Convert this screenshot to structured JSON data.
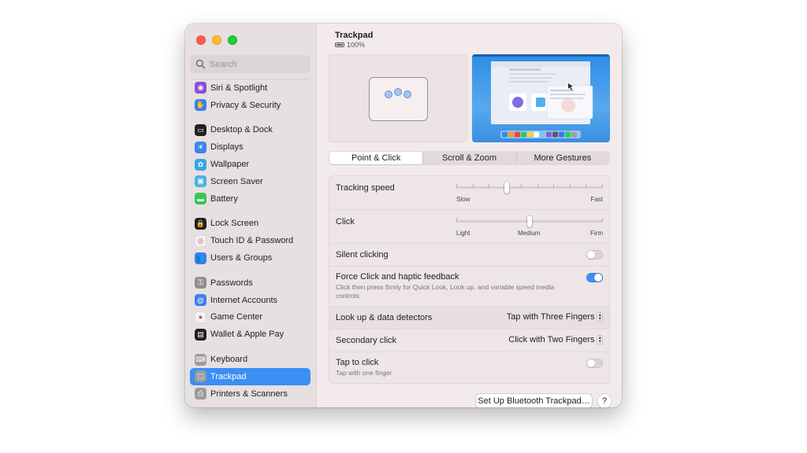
{
  "search": {
    "placeholder": "Search"
  },
  "sidebar": {
    "groups": [
      [
        {
          "label": "Siri & Spotlight",
          "icon": "siri-icon",
          "color": "#8a4fd8"
        },
        {
          "label": "Privacy & Security",
          "icon": "hand-icon",
          "color": "#3a7ef0"
        }
      ],
      [
        {
          "label": "Desktop & Dock",
          "icon": "dock-icon",
          "color": "#222222"
        },
        {
          "label": "Displays",
          "icon": "sun-icon",
          "color": "#3a85f0"
        },
        {
          "label": "Wallpaper",
          "icon": "flower-icon",
          "color": "#32a7e6"
        },
        {
          "label": "Screen Saver",
          "icon": "screensaver-icon",
          "color": "#4ab3e3"
        },
        {
          "label": "Battery",
          "icon": "battery-icon",
          "color": "#34c759"
        }
      ],
      [
        {
          "label": "Lock Screen",
          "icon": "lock-icon",
          "color": "#1f1f1f"
        },
        {
          "label": "Touch ID & Password",
          "icon": "fingerprint-icon",
          "color": "#f2f2f2"
        },
        {
          "label": "Users & Groups",
          "icon": "users-icon",
          "color": "#3a7ef0"
        }
      ],
      [
        {
          "label": "Passwords",
          "icon": "key-icon",
          "color": "#8e8e93"
        },
        {
          "label": "Internet Accounts",
          "icon": "at-icon",
          "color": "#3a7ef0"
        },
        {
          "label": "Game Center",
          "icon": "game-center-icon",
          "color": "#f2f2f2"
        },
        {
          "label": "Wallet & Apple Pay",
          "icon": "wallet-icon",
          "color": "#1f1f1f"
        }
      ],
      [
        {
          "label": "Keyboard",
          "icon": "keyboard-icon",
          "color": "#9a9a9f"
        },
        {
          "label": "Trackpad",
          "icon": "trackpad-icon",
          "color": "#9a9a9f",
          "active": true
        },
        {
          "label": "Printers & Scanners",
          "icon": "printer-icon",
          "color": "#9a9a9f"
        }
      ]
    ]
  },
  "header": {
    "title": "Trackpad",
    "battery": "100%"
  },
  "tabs": [
    {
      "label": "Point & Click",
      "active": true
    },
    {
      "label": "Scroll & Zoom"
    },
    {
      "label": "More Gestures"
    }
  ],
  "settings": {
    "tracking_speed": {
      "label": "Tracking speed",
      "min_label": "Slow",
      "max_label": "Fast",
      "level": 0.34
    },
    "click": {
      "label": "Click",
      "left_label": "Light",
      "mid_label": "Medium",
      "right_label": "Firm",
      "level": 0.5
    },
    "silent_clicking": {
      "label": "Silent clicking",
      "on": false
    },
    "force_click": {
      "label": "Force Click and haptic feedback",
      "description": "Click then press firmly for Quick Look, Look up, and variable speed media controls.",
      "on": true
    },
    "look_up": {
      "label": "Look up & data detectors",
      "value": "Tap with Three Fingers"
    },
    "secondary_click": {
      "label": "Secondary click",
      "value": "Click with Two Fingers"
    },
    "tap_to_click": {
      "label": "Tap to click",
      "description": "Tap with one finger",
      "on": false
    }
  },
  "footer": {
    "setup_button": "Set Up Bluetooth Trackpad…",
    "help": "?"
  },
  "colors": {
    "accent": "#3b8ef4"
  }
}
